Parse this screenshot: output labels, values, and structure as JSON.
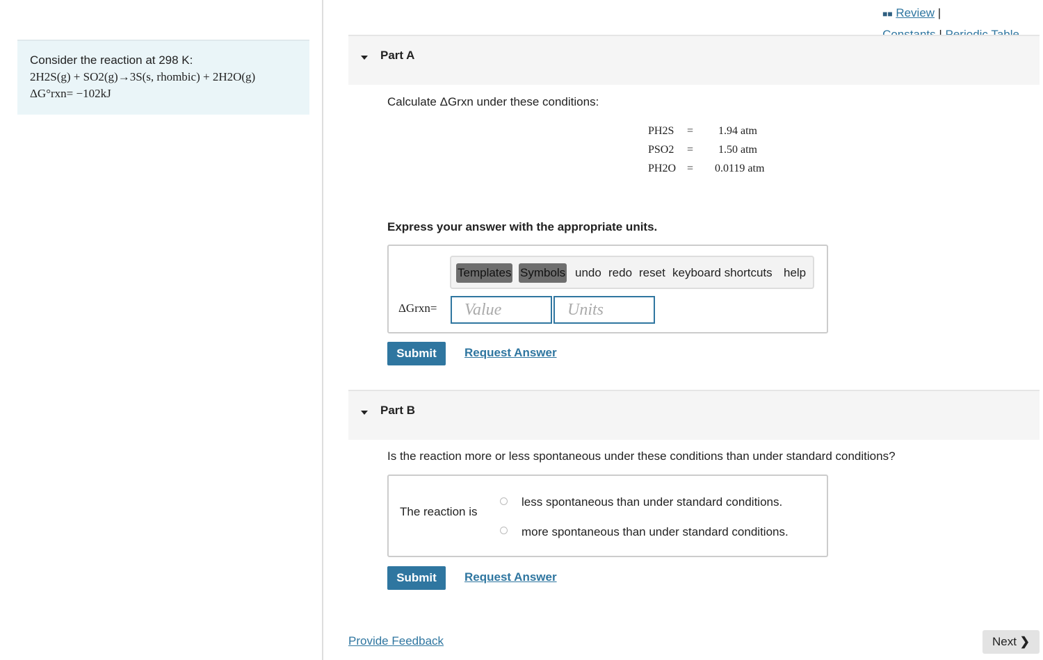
{
  "problem": {
    "intro": "Consider the reaction at 298 K:",
    "reaction": "2H2S(g) + SO2(g)→3S(s, rhombic) + 2H2O(g)",
    "delta_g": "ΔG°rxn= −102kJ"
  },
  "top_links": {
    "review": "Review",
    "constants": "Constants",
    "periodic_table": "Periodic Table",
    "separator": "|"
  },
  "part_a": {
    "title": "Part A",
    "prompt": "Calculate ΔGrxn under these conditions:",
    "conditions": [
      {
        "label": "PH2S",
        "eq": "=",
        "value": "1.94 atm"
      },
      {
        "label": "PSO2",
        "eq": "=",
        "value": "1.50 atm"
      },
      {
        "label": "PH2O",
        "eq": "=",
        "value": "0.0119 atm"
      }
    ],
    "instruction": "Express your answer with the appropriate units.",
    "toolbar": [
      "Templates",
      "Symbols",
      "undo",
      "redo",
      "reset",
      "keyboard shortcuts",
      "help"
    ],
    "answer_label": "ΔGrxn=",
    "value_placeholder": "Value",
    "units_placeholder": "Units",
    "submit": "Submit",
    "request_answer": "Request Answer"
  },
  "part_b": {
    "title": "Part B",
    "prompt": "Is the reaction more or less spontaneous under these conditions than under standard conditions?",
    "lead": "The reaction is",
    "options": [
      "less spontaneous than under standard conditions.",
      "more spontaneous than under standard conditions."
    ],
    "submit": "Submit",
    "request_answer": "Request Answer"
  },
  "footer": {
    "feedback": "Provide Feedback",
    "next": "Next"
  },
  "colors": {
    "accent": "#2f76a0",
    "panel": "#eaf5f8"
  }
}
